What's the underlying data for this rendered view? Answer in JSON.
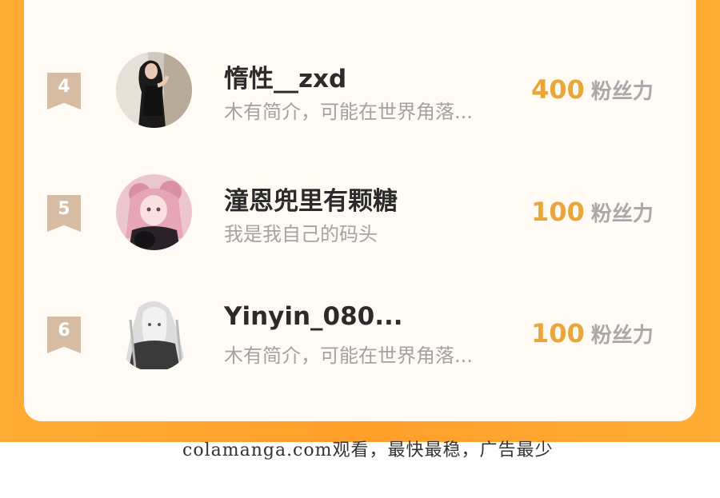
{
  "leaderboard": {
    "rows": [
      {
        "rank": "4",
        "name": "惰性__zxd",
        "bio": "木有简介，可能在世界角落...",
        "score": "400",
        "unit": "粉丝力",
        "avatar": "woman-black-dress-photo-avatar"
      },
      {
        "rank": "5",
        "name": "潼恩兜里有颗糖",
        "bio": "我是我自己的码头",
        "score": "100",
        "unit": "粉丝力",
        "avatar": "anime-pink-hair-girl-avatar"
      },
      {
        "rank": "6",
        "name": "Yinyin_080...",
        "bio": "木有简介，可能在世界角落...",
        "score": "100",
        "unit": "粉丝力",
        "avatar": "monochrome-long-hair-girl-avatar"
      }
    ]
  },
  "watermark": "colamanga.com观看，最快最稳，广告最少",
  "colors": {
    "background_orange": "#ffa530",
    "card": "#fffaf3",
    "rank_badge": "#d6bca3",
    "score": "#e9a63b",
    "name": "#2b2b2b",
    "bio": "#a3a3a3"
  }
}
